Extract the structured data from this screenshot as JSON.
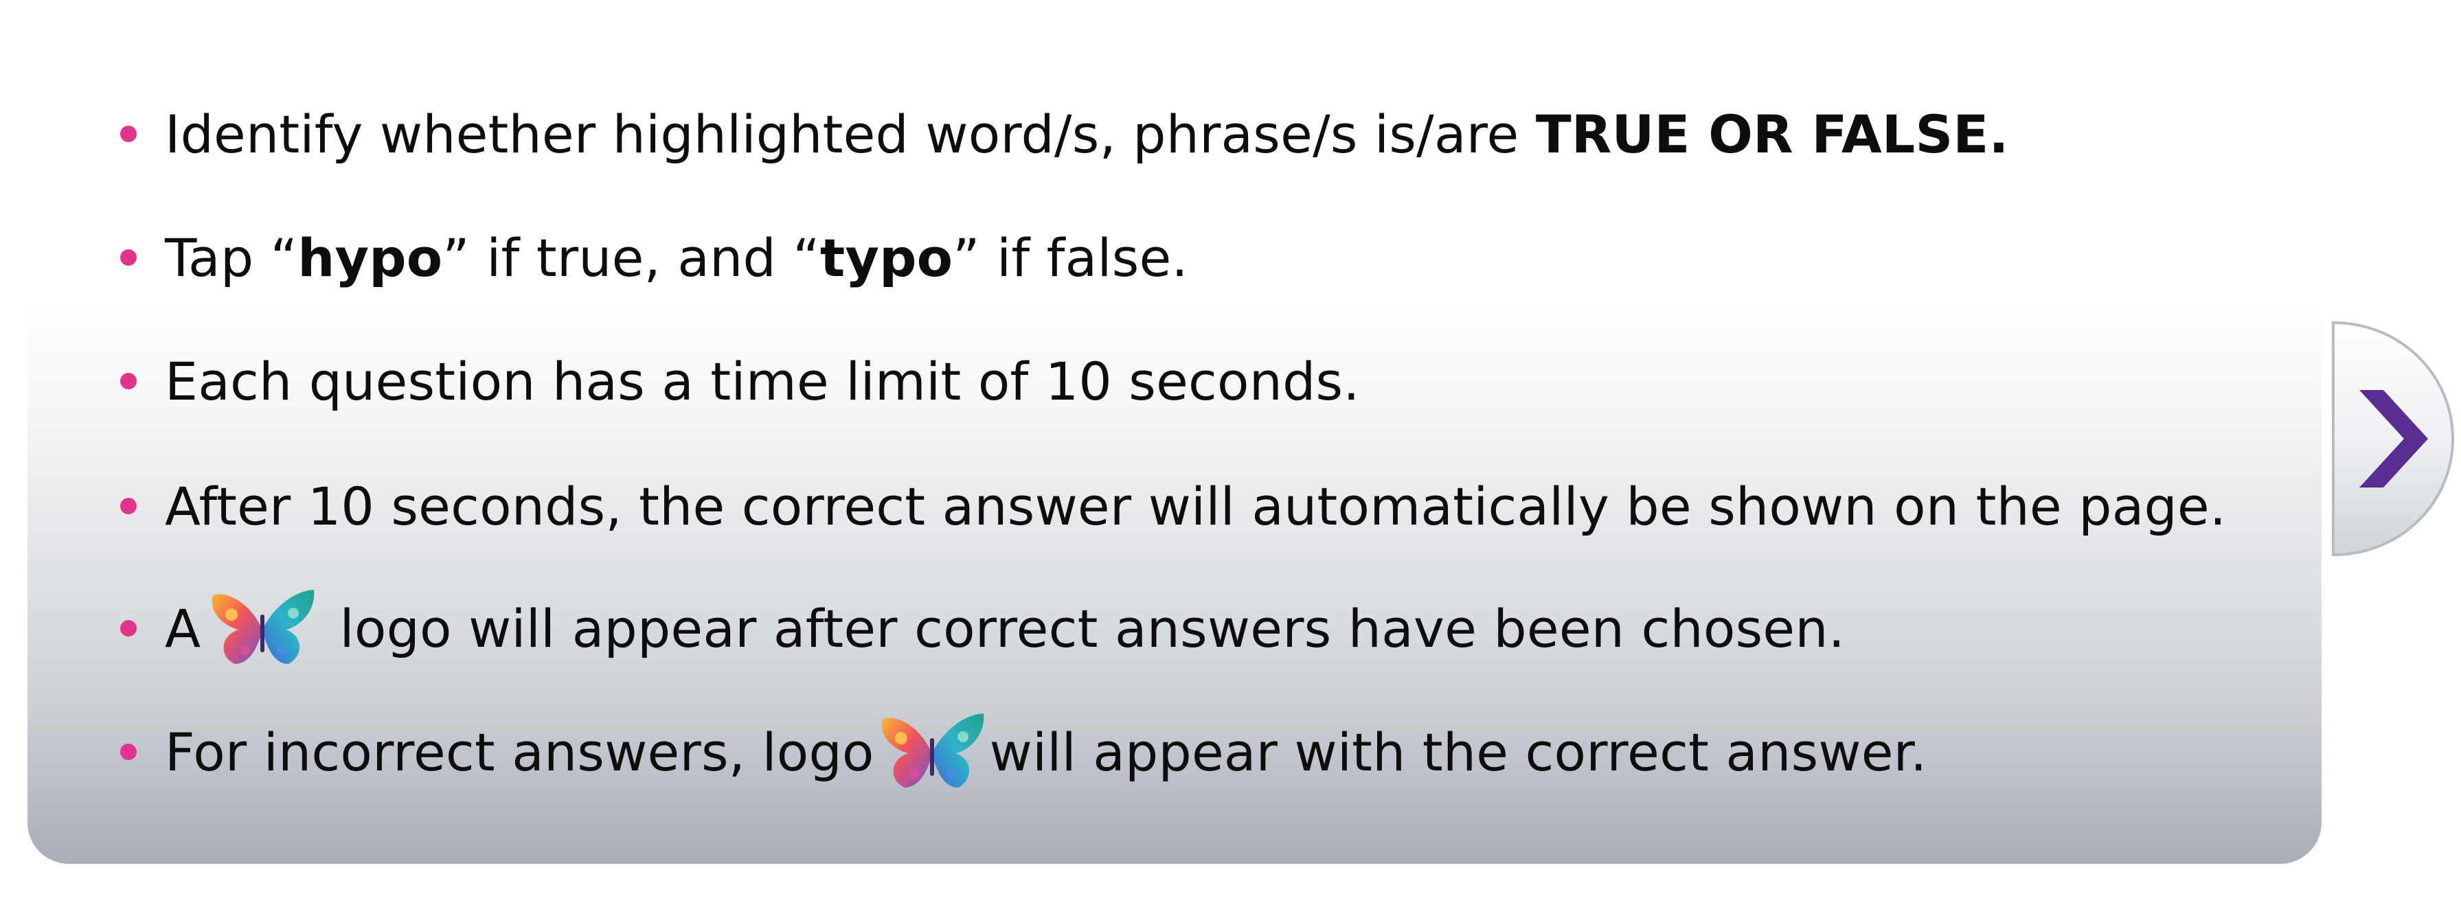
{
  "instructions": {
    "items": [
      {
        "pre": "Identify whether highlighted word/s, phrase/s is/are ",
        "bold": "TRUE OR FALSE."
      },
      {
        "t1": "Tap “",
        "b1": "hypo",
        "t2": "” if true, and “",
        "b2": "typo",
        "t3": "” if false."
      },
      {
        "text": "Each question has a time limit of 10 seconds."
      },
      {
        "text": "After 10 seconds, the correct answer will automatically be shown on the page."
      },
      {
        "pre": "A",
        "icon": "butterfly-logo-icon",
        "post": " logo will appear after correct answers have been chosen."
      },
      {
        "pre": "For incorrect answers, logo",
        "icon": "butterfly-logo-icon",
        "post": "will appear with the correct answer."
      }
    ]
  },
  "colors": {
    "bullet": "#e0358a",
    "chevron": "#5a2d91",
    "panel_bottom": "#a9aeb6"
  },
  "navigation": {
    "next_icon": "chevron-right-icon"
  }
}
